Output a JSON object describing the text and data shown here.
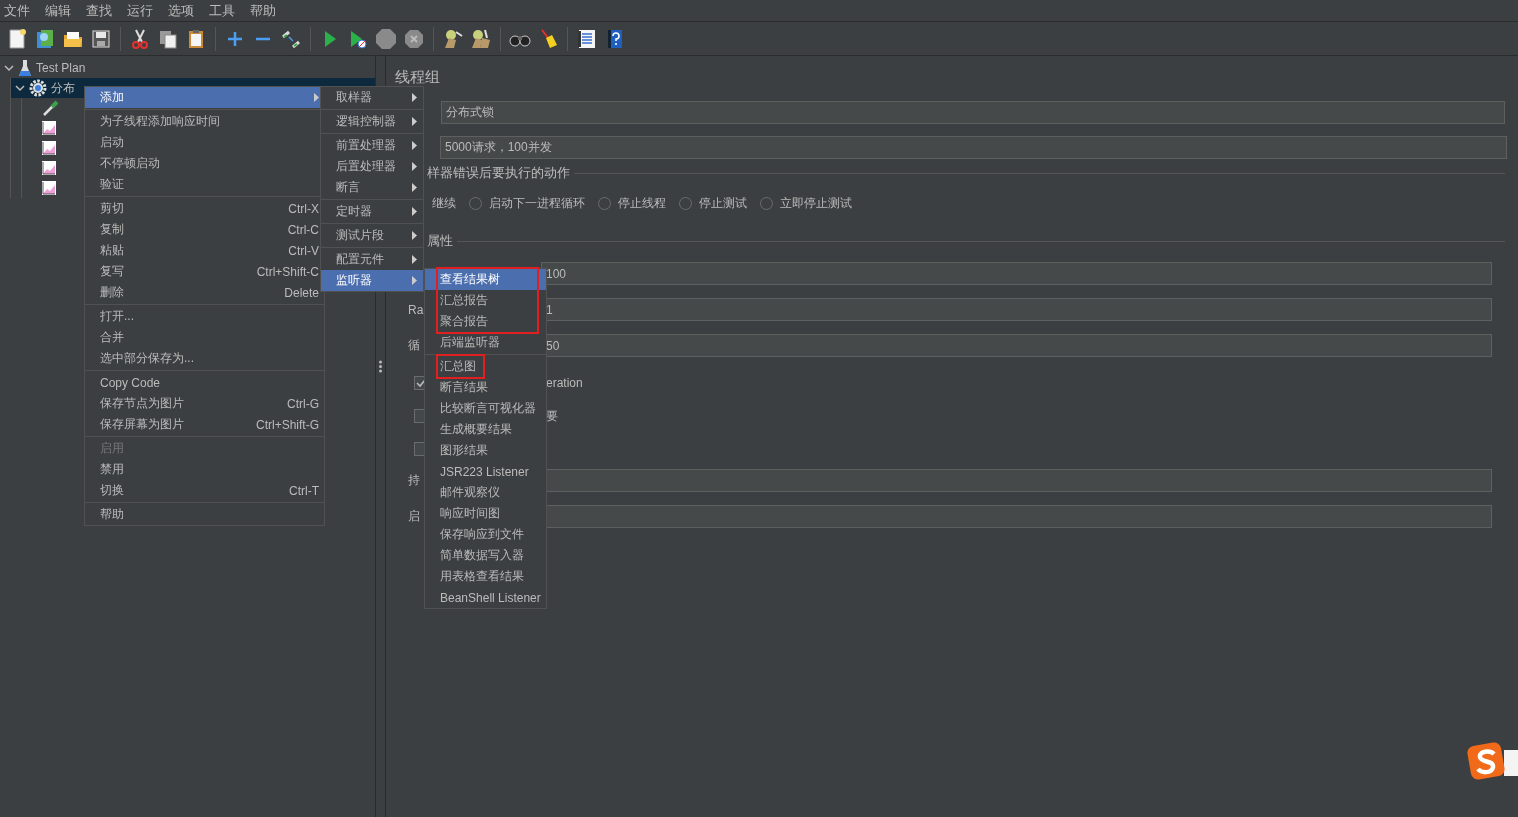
{
  "menu_bar": [
    "文件",
    "编辑",
    "查找",
    "运行",
    "选项",
    "工具",
    "帮助"
  ],
  "tree": [
    {
      "kind": "flask",
      "label": "Test Plan",
      "expanded": true,
      "selected": false,
      "children": [
        {
          "kind": "gear",
          "label": "分布",
          "expanded": true,
          "selected": true,
          "children": [
            {
              "kind": "pipette"
            },
            {
              "kind": "chart"
            },
            {
              "kind": "chart"
            },
            {
              "kind": "chart"
            },
            {
              "kind": "chart"
            }
          ]
        }
      ]
    }
  ],
  "panel": {
    "title": "线程组",
    "name_value": "分布式锁",
    "comment_value": "5000请求，100并发",
    "error_group_label": "样器错误后要执行的动作",
    "error_actions": [
      {
        "kind": "text",
        "label": "继续"
      },
      {
        "kind": "radio",
        "label": "启动下一进程循环",
        "selected": false
      },
      {
        "kind": "radio",
        "label": "停止线程",
        "selected": false
      },
      {
        "kind": "radio",
        "label": "停止测试",
        "selected": false
      },
      {
        "kind": "radio",
        "label": "立即停止测试",
        "selected": false
      }
    ],
    "properties_label": "属性",
    "rows": [
      {
        "kind": "field",
        "value": "100"
      },
      {
        "kind": "field",
        "label": "Ra",
        "value": "1"
      },
      {
        "kind": "field",
        "label": "循",
        "value": "50"
      },
      {
        "kind": "checkbox",
        "checked": true,
        "text": "eration"
      },
      {
        "kind": "checkbox",
        "checked": false,
        "text": "要"
      },
      {
        "kind": "checkbox",
        "checked": false
      },
      {
        "kind": "field",
        "label": "持"
      },
      {
        "kind": "field",
        "label": "启"
      }
    ]
  },
  "context_menu": [
    {
      "kind": "item",
      "label": "添加",
      "submenu": true,
      "selected": true,
      "disabled": false
    },
    {
      "kind": "separator"
    },
    {
      "kind": "item",
      "label": "为子线程添加响应时间",
      "submenu": false,
      "selected": false,
      "disabled": false
    },
    {
      "kind": "item",
      "label": "启动",
      "submenu": false,
      "selected": false,
      "disabled": false
    },
    {
      "kind": "item",
      "label": "不停顿启动",
      "submenu": false,
      "selected": false,
      "disabled": false
    },
    {
      "kind": "item",
      "label": "验证",
      "submenu": false,
      "selected": false,
      "disabled": false
    },
    {
      "kind": "separator"
    },
    {
      "kind": "item",
      "label": "剪切",
      "shortcut": "Ctrl-X",
      "submenu": false,
      "selected": false,
      "disabled": false
    },
    {
      "kind": "item",
      "label": "复制",
      "shortcut": "Ctrl-C",
      "submenu": false,
      "selected": false,
      "disabled": false
    },
    {
      "kind": "item",
      "label": "粘贴",
      "shortcut": "Ctrl-V",
      "submenu": false,
      "selected": false,
      "disabled": false
    },
    {
      "kind": "item",
      "label": "复写",
      "shortcut": "Ctrl+Shift-C",
      "submenu": false,
      "selected": false,
      "disabled": false
    },
    {
      "kind": "item",
      "label": "删除",
      "shortcut": "Delete",
      "submenu": false,
      "selected": false,
      "disabled": false
    },
    {
      "kind": "separator"
    },
    {
      "kind": "item",
      "label": "打开...",
      "submenu": false,
      "selected": false,
      "disabled": false
    },
    {
      "kind": "item",
      "label": "合并",
      "submenu": false,
      "selected": false,
      "disabled": false
    },
    {
      "kind": "item",
      "label": "选中部分保存为...",
      "submenu": false,
      "selected": false,
      "disabled": false
    },
    {
      "kind": "separator"
    },
    {
      "kind": "item",
      "label": "Copy Code",
      "submenu": false,
      "selected": false,
      "disabled": false
    },
    {
      "kind": "item",
      "label": "保存节点为图片",
      "shortcut": "Ctrl-G",
      "submenu": false,
      "selected": false,
      "disabled": false
    },
    {
      "kind": "item",
      "label": "保存屏幕为图片",
      "shortcut": "Ctrl+Shift-G",
      "submenu": false,
      "selected": false,
      "disabled": false
    },
    {
      "kind": "separator"
    },
    {
      "kind": "item",
      "label": "启用",
      "submenu": false,
      "selected": false,
      "disabled": true
    },
    {
      "kind": "item",
      "label": "禁用",
      "submenu": false,
      "selected": false,
      "disabled": false
    },
    {
      "kind": "item",
      "label": "切换",
      "shortcut": "Ctrl-T",
      "submenu": false,
      "selected": false,
      "disabled": false
    },
    {
      "kind": "separator"
    },
    {
      "kind": "item",
      "label": "帮助",
      "submenu": false,
      "selected": false,
      "disabled": false
    }
  ],
  "add_submenu": [
    {
      "kind": "item",
      "label": "取样器",
      "submenu": true,
      "selected": false
    },
    {
      "kind": "separator"
    },
    {
      "kind": "item",
      "label": "逻辑控制器",
      "submenu": true,
      "selected": false
    },
    {
      "kind": "separator"
    },
    {
      "kind": "item",
      "label": "前置处理器",
      "submenu": true,
      "selected": false
    },
    {
      "kind": "item",
      "label": "后置处理器",
      "submenu": true,
      "selected": false
    },
    {
      "kind": "item",
      "label": "断言",
      "submenu": true,
      "selected": false
    },
    {
      "kind": "separator"
    },
    {
      "kind": "item",
      "label": "定时器",
      "submenu": true,
      "selected": false
    },
    {
      "kind": "separator"
    },
    {
      "kind": "item",
      "label": "测试片段",
      "submenu": true,
      "selected": false
    },
    {
      "kind": "separator"
    },
    {
      "kind": "item",
      "label": "配置元件",
      "submenu": true,
      "selected": false
    },
    {
      "kind": "item",
      "label": "监听器",
      "submenu": true,
      "selected": true
    }
  ],
  "listener_submenu": [
    {
      "kind": "item",
      "label": "查看结果树",
      "selected": true,
      "red_box": true
    },
    {
      "kind": "item",
      "label": "汇总报告",
      "selected": false,
      "red_box": true
    },
    {
      "kind": "item",
      "label": "聚合报告",
      "selected": false,
      "red_box": true
    },
    {
      "kind": "item",
      "label": "后端监听器",
      "selected": false,
      "red_box": false
    },
    {
      "kind": "separator"
    },
    {
      "kind": "item",
      "label": "汇总图",
      "selected": false,
      "red_box": true
    },
    {
      "kind": "item",
      "label": "断言结果",
      "selected": false,
      "red_box": false
    },
    {
      "kind": "item",
      "label": "比较断言可视化器",
      "selected": false,
      "red_box": false
    },
    {
      "kind": "item",
      "label": "生成概要结果",
      "selected": false,
      "red_box": false
    },
    {
      "kind": "item",
      "label": "图形结果",
      "selected": false,
      "red_box": false
    },
    {
      "kind": "item",
      "label": "JSR223 Listener",
      "selected": false,
      "red_box": false
    },
    {
      "kind": "item",
      "label": "邮件观察仪",
      "selected": false,
      "red_box": false
    },
    {
      "kind": "item",
      "label": "响应时间图",
      "selected": false,
      "red_box": false
    },
    {
      "kind": "item",
      "label": "保存响应到文件",
      "selected": false,
      "red_box": false
    },
    {
      "kind": "item",
      "label": "简单数据写入器",
      "selected": false,
      "red_box": false
    },
    {
      "kind": "item",
      "label": "用表格查看结果",
      "selected": false,
      "red_box": false
    },
    {
      "kind": "item",
      "label": "BeanShell Listener",
      "selected": false,
      "red_box": false
    }
  ]
}
